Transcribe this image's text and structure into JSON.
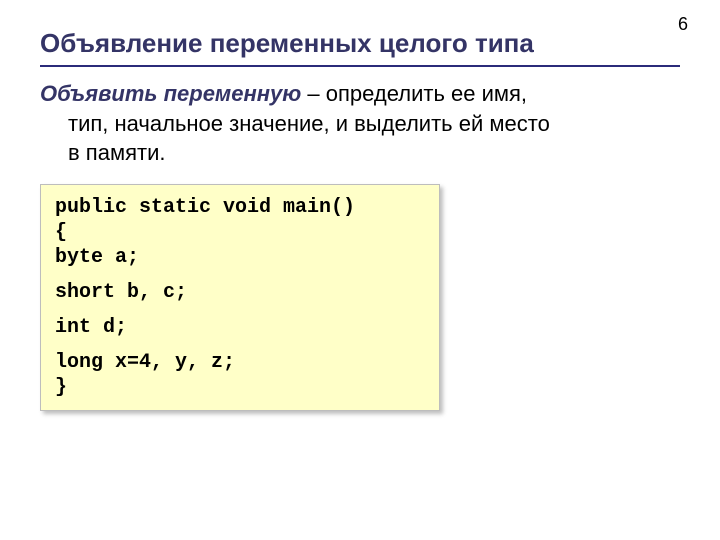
{
  "page_number": "6",
  "title": "Объявление переменных целого типа",
  "definition": {
    "term": "Объявить переменную",
    "dash": " – ",
    "line1_rest": "определить ее имя,",
    "line2": "тип, начальное значение, и выделить ей место",
    "line3": "в памяти."
  },
  "code": {
    "l1": "public static void main()",
    "l2": "{",
    "l3": "byte a;",
    "l4": "short b, c;",
    "l5": "int d;",
    "l6": "long x=4, y, z;",
    "l7": "}"
  }
}
